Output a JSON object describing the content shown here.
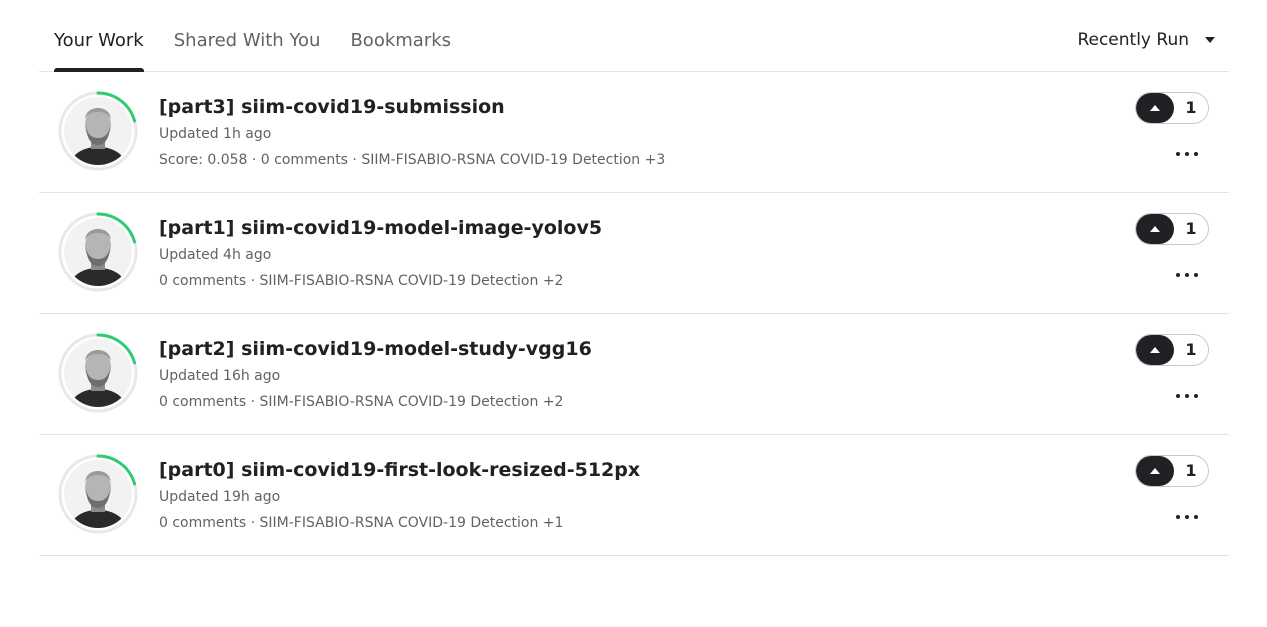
{
  "tabs": [
    {
      "label": "Your Work",
      "active": true
    },
    {
      "label": "Shared With You",
      "active": false
    },
    {
      "label": "Bookmarks",
      "active": false
    }
  ],
  "sort": {
    "label": "Recently Run"
  },
  "colors": {
    "progress_ring": "#20BEFF",
    "accent_green": "#2ecc71",
    "dark": "#202124"
  },
  "items": [
    {
      "title": "[part3] siim-covid19-submission",
      "updated": "Updated 1h ago",
      "meta": "Score: 0.058 · 0 comments · SIIM-FISABIO-RSNA COVID-19 Detection +3",
      "votes": "1"
    },
    {
      "title": "[part1] siim-covid19-model-image-yolov5",
      "updated": "Updated 4h ago",
      "meta": "0 comments · SIIM-FISABIO-RSNA COVID-19 Detection +2",
      "votes": "1"
    },
    {
      "title": "[part2] siim-covid19-model-study-vgg16",
      "updated": "Updated 16h ago",
      "meta": "0 comments · SIIM-FISABIO-RSNA COVID-19 Detection +2",
      "votes": "1"
    },
    {
      "title": "[part0] siim-covid19-first-look-resized-512px",
      "updated": "Updated 19h ago",
      "meta": "0 comments · SIIM-FISABIO-RSNA COVID-19 Detection +1",
      "votes": "1"
    }
  ]
}
